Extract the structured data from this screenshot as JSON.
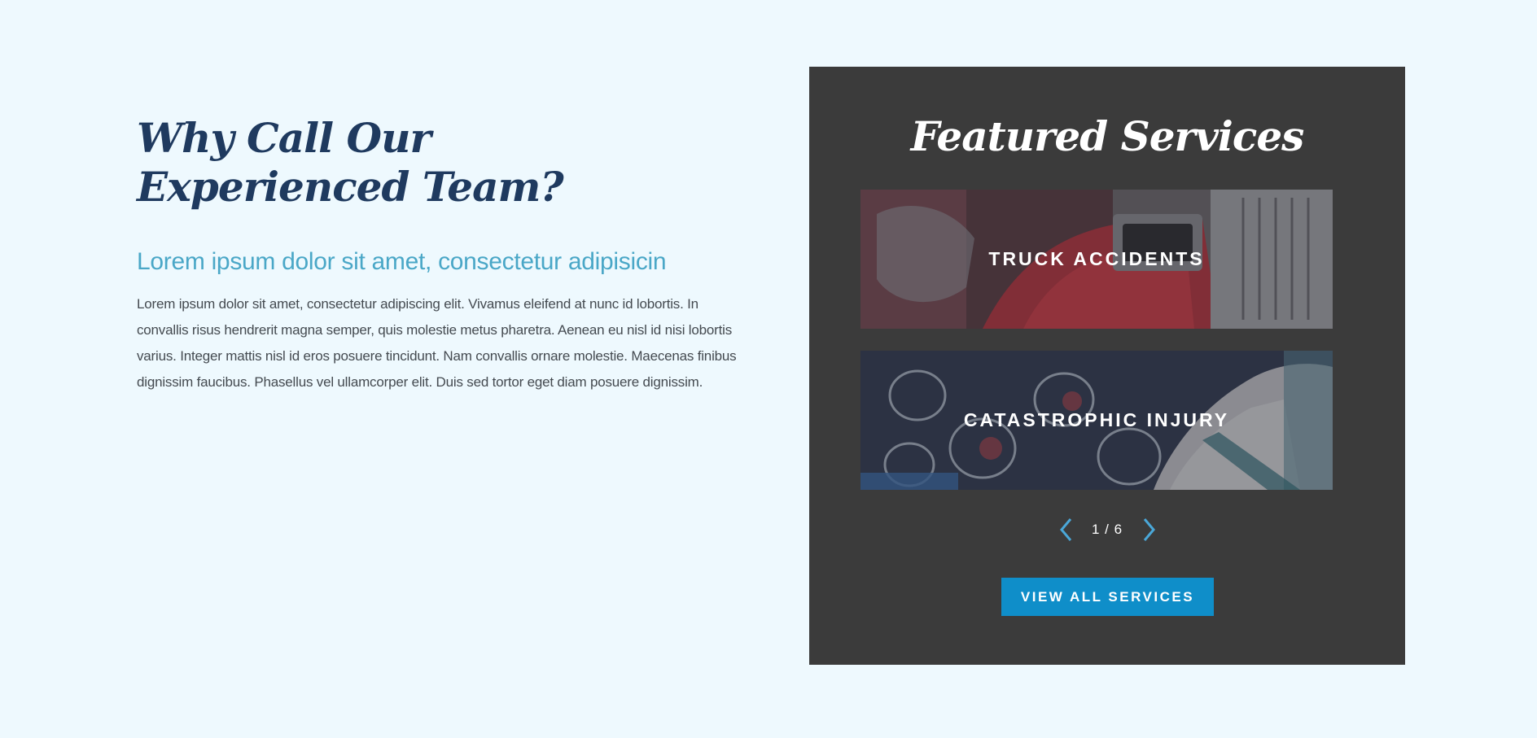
{
  "intro": {
    "headline_line1": "Why Call Our",
    "headline_line2": "Experienced Team?",
    "subheading": "Lorem ipsum dolor sit amet, consectetur adipisicin",
    "body": "Lorem ipsum dolor sit amet, consectetur adipiscing elit. Vivamus eleifend at nunc id lobortis. In convallis risus hendrerit magna semper, quis molestie metus pharetra. Aenean eu nisl id nisi lobortis varius. Integer mattis nisl id eros posuere tincidunt. Nam convallis ornare molestie. Maecenas finibus dignissim faucibus. Phasellus vel ullamcorper elit. Duis sed tortor eget diam posuere dignissim."
  },
  "featured": {
    "title": "Featured Services",
    "services": [
      {
        "label": "TRUCK ACCIDENTS"
      },
      {
        "label": "CATASTROPHIC INJURY"
      }
    ],
    "pager": {
      "current": "1",
      "total": "6",
      "text": "1 / 6"
    },
    "view_all_label": "VIEW ALL SERVICES"
  },
  "colors": {
    "page_background": "#eef9fe",
    "headline": "#1f3a5f",
    "subheading": "#4aa7c7",
    "panel_background": "#3b3b3b",
    "accent_button": "#0f8ec9",
    "pager_arrow": "#4aa7d8"
  }
}
